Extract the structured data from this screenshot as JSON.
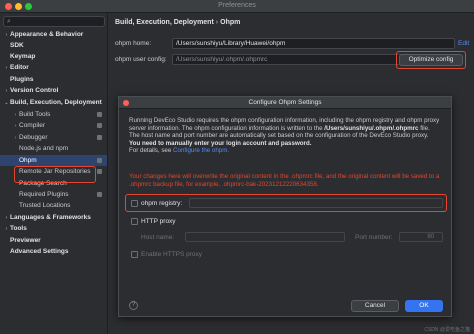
{
  "window": {
    "title": "Preferences"
  },
  "sidebar": {
    "items": [
      {
        "label": "Appearance & Behavior",
        "chev": "›",
        "level": 0
      },
      {
        "label": "SDK",
        "chev": "",
        "level": 0
      },
      {
        "label": "Keymap",
        "chev": "",
        "level": 0
      },
      {
        "label": "Editor",
        "chev": "›",
        "level": 0
      },
      {
        "label": "Plugins",
        "chev": "",
        "level": 0
      },
      {
        "label": "Version Control",
        "chev": "›",
        "level": 0
      },
      {
        "label": "Build, Execution, Deployment",
        "chev": "⌄",
        "level": 0
      },
      {
        "label": "Build Tools",
        "chev": "›",
        "level": 1
      },
      {
        "label": "Compiler",
        "chev": "›",
        "level": 1
      },
      {
        "label": "Debugger",
        "chev": "›",
        "level": 1
      },
      {
        "label": "Node.js and npm",
        "chev": "",
        "level": 1
      },
      {
        "label": "Ohpm",
        "chev": "",
        "level": 1
      },
      {
        "label": "Remote Jar Repositories",
        "chev": "",
        "level": 1
      },
      {
        "label": "Package Search",
        "chev": "",
        "level": 1
      },
      {
        "label": "Required Plugins",
        "chev": "",
        "level": 1
      },
      {
        "label": "Trusted Locations",
        "chev": "",
        "level": 1
      },
      {
        "label": "Languages & Frameworks",
        "chev": "›",
        "level": 0
      },
      {
        "label": "Tools",
        "chev": "›",
        "level": 0
      },
      {
        "label": "Previewer",
        "chev": "",
        "level": 0
      },
      {
        "label": "Advanced Settings",
        "chev": "",
        "level": 0
      }
    ]
  },
  "main": {
    "breadcrumb": {
      "parent": "Build, Execution, Deployment",
      "sep": "›",
      "current": "Ohpm"
    },
    "ohpm_home_label": "ohpm home:",
    "ohpm_home_value": "/Users/sunshiyu/Library/Huawei/ohpm",
    "edit_link": "Edit",
    "user_config_label": "ohpm user config:",
    "user_config_value": "/Users/sunshiyu/.ohpm/.ohpmrc",
    "optimize_button": "Optimize config"
  },
  "dialog": {
    "title": "Configure Ohpm Settings",
    "intro_1": "Running DevEco Studio requires the ohpm configuration information, including the ohpm registry and ohpm proxy server information. The ohpm configuration information is written to the",
    "path": "/Users/sunshiyu/.ohpm/.ohpmrc",
    "file_word": "file.",
    "intro_2": "The host name and port number are automatically set based on the configuration of the DevEco Studio proxy.",
    "bold_note": "You need to manually enter your login account and password.",
    "details_prefix": "For details, see",
    "details_link": "Configure the ohpm.",
    "warning": "Your changes here will overwrite the original content in the .ohpmrc file, and the original content will be saved to a .ohpmrc backup file, for example, .ohpmrc-bak-20231212220634358.",
    "registry_label": "ohpm registry:",
    "http_proxy_label": "HTTP proxy",
    "host_label": "Host name:",
    "port_label": "Port number:",
    "port_value": "80",
    "https_label": "Enable HTTPS proxy",
    "cancel": "Cancel",
    "ok": "OK",
    "help": "?"
  },
  "watermark": "CSDN @爱吃鱼之猫",
  "colors": {
    "accent": "#548af7",
    "selected": "#2e436e",
    "highlight": "#e4462f",
    "primary_button": "#3574f0"
  }
}
